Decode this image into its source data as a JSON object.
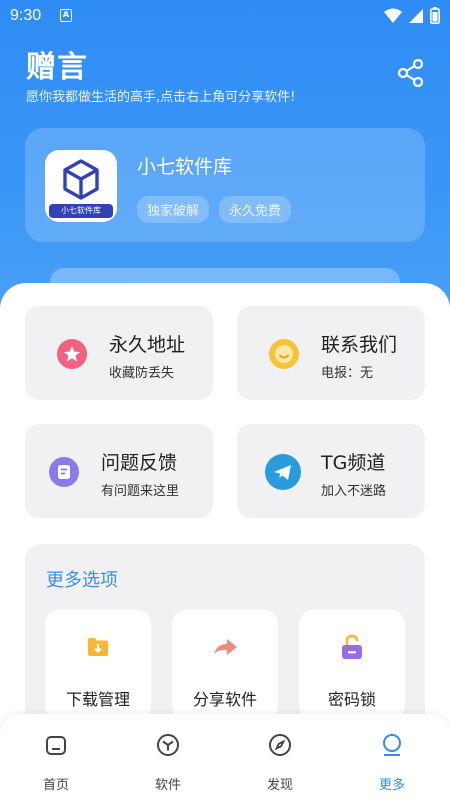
{
  "status_bar": {
    "time": "9:30",
    "notif_letter": "A"
  },
  "header": {
    "title": "赠言",
    "subtitle": "愿你我都做生活的高手,点击右上角可分享软件!"
  },
  "app_card": {
    "logo_text": "小七软件库",
    "name": "小七软件库",
    "tags": [
      "独家破解",
      "永久免费"
    ]
  },
  "features": [
    {
      "title": "永久地址",
      "subtitle": "收藏防丢失",
      "icon": "star-icon",
      "color": "#f0627f"
    },
    {
      "title": "联系我们",
      "subtitle": "电报：无",
      "icon": "smile-icon",
      "color": "#f6c23a"
    },
    {
      "title": "问题反馈",
      "subtitle": "有问题来这里",
      "icon": "feedback-icon",
      "color": "#8c79e8"
    },
    {
      "title": "TG频道",
      "subtitle": "加入不迷路",
      "icon": "telegram-icon",
      "color": "#2a9bdc"
    }
  ],
  "more": {
    "title": "更多选项",
    "options": [
      {
        "label": "下载管理",
        "icon": "download-folder-icon",
        "color": "#f7b733"
      },
      {
        "label": "分享软件",
        "icon": "share-arrow-icon",
        "color": "#f08a80"
      },
      {
        "label": "密码锁",
        "icon": "lock-icon",
        "color": "#9a6be8"
      }
    ]
  },
  "tabs": [
    {
      "label": "首页",
      "icon": "home-icon"
    },
    {
      "label": "软件",
      "icon": "cube-icon"
    },
    {
      "label": "发现",
      "icon": "compass-icon"
    },
    {
      "label": "更多",
      "icon": "more-icon",
      "active": true
    }
  ],
  "colors": {
    "primary": "#2f8cf5",
    "accent_text": "#3a8ef0"
  }
}
